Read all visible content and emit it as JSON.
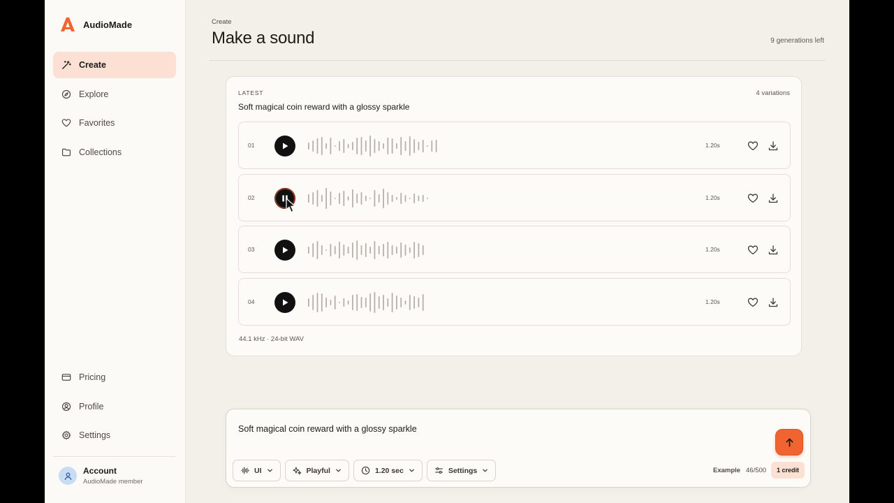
{
  "app": {
    "name": "AudioMade",
    "brand_color": "#f06431"
  },
  "sidebar": {
    "nav": [
      {
        "label": "Create",
        "icon": "magic-wand-icon",
        "active": true
      },
      {
        "label": "Explore",
        "icon": "compass-icon",
        "active": false
      },
      {
        "label": "Favorites",
        "icon": "heart-icon",
        "active": false
      },
      {
        "label": "Collections",
        "icon": "folder-icon",
        "active": false
      }
    ],
    "bottom_nav": [
      {
        "label": "Pricing",
        "icon": "credit-card-icon"
      },
      {
        "label": "Profile",
        "icon": "user-circle-icon"
      },
      {
        "label": "Settings",
        "icon": "gear-icon"
      }
    ],
    "account": {
      "name": "Account",
      "subtitle": "AudioMade member"
    }
  },
  "header": {
    "breadcrumb": "Create",
    "title": "Make a sound",
    "generations_left": "9 generations left"
  },
  "latest": {
    "label": "LATEST",
    "variations": "4 variations",
    "prompt": "Soft magical coin reward with a glossy sparkle",
    "rows": [
      {
        "num": "01",
        "duration": "1.20s",
        "state": "play"
      },
      {
        "num": "02",
        "duration": "1.20s",
        "state": "pause"
      },
      {
        "num": "03",
        "duration": "1.20s",
        "state": "play"
      },
      {
        "num": "04",
        "duration": "1.20s",
        "state": "play"
      }
    ],
    "meta": "44.1 kHz · 24-bit WAV"
  },
  "composer": {
    "text": "Soft magical coin reward with a glossy sparkle",
    "chips": [
      {
        "label": "UI",
        "icon": "waveform-icon"
      },
      {
        "label": "Playful",
        "icon": "sparkles-icon"
      },
      {
        "label": "1.20 sec",
        "icon": "clock-icon"
      },
      {
        "label": "Settings",
        "icon": "sliders-icon"
      }
    ],
    "example_label": "Example",
    "char_count": "46/500",
    "credit": "1 credit"
  }
}
